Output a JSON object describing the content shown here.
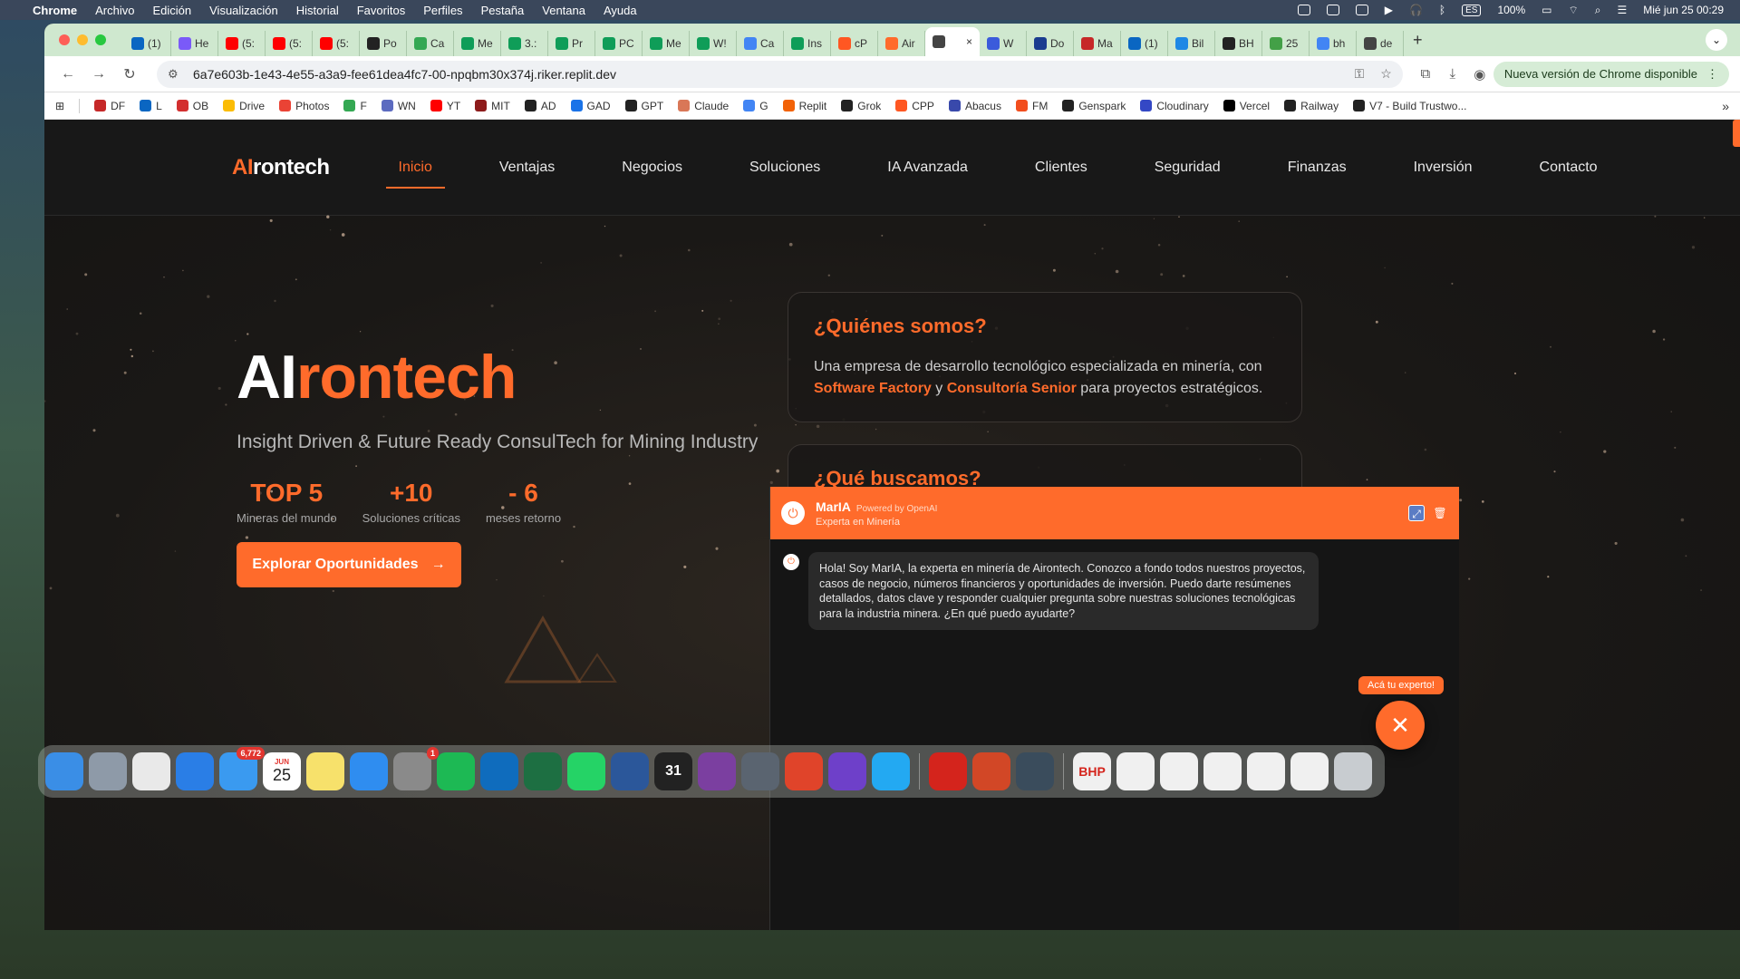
{
  "menubar": {
    "app": "Chrome",
    "items": [
      "Archivo",
      "Edición",
      "Visualización",
      "Historial",
      "Favoritos",
      "Perfiles",
      "Pestaña",
      "Ventana",
      "Ayuda"
    ],
    "battery": "100%",
    "input_lang": "ES",
    "clock": "Mié jun 25  00:29"
  },
  "tabs": [
    {
      "label": "(1)",
      "color": "#0a66c2"
    },
    {
      "label": "He",
      "color": "#7a5af8"
    },
    {
      "label": "(5:",
      "color": "#ff0000"
    },
    {
      "label": "(5:",
      "color": "#ff0000"
    },
    {
      "label": "(5:",
      "color": "#ff0000"
    },
    {
      "label": "Po",
      "color": "#222222"
    },
    {
      "label": "Ca",
      "color": "#34a853"
    },
    {
      "label": "Me",
      "color": "#0f9d58"
    },
    {
      "label": "3.:",
      "color": "#0f9d58"
    },
    {
      "label": "Pr",
      "color": "#0f9d58"
    },
    {
      "label": "PC",
      "color": "#0f9d58"
    },
    {
      "label": "Me",
      "color": "#0f9d58"
    },
    {
      "label": "W!",
      "color": "#0f9d58"
    },
    {
      "label": "Ca",
      "color": "#4285f4"
    },
    {
      "label": "Ins",
      "color": "#0f9d58"
    },
    {
      "label": "cP",
      "color": "#ff5722"
    },
    {
      "label": "Air",
      "color": "#ff6b2b"
    },
    {
      "label": "",
      "color": "#444444",
      "active": true
    },
    {
      "label": "W",
      "color": "#3b5bdb"
    },
    {
      "label": "Do",
      "color": "#1a3c8f"
    },
    {
      "label": "Ma",
      "color": "#c62828"
    },
    {
      "label": "(1)",
      "color": "#0a66c2"
    },
    {
      "label": "Bil",
      "color": "#1e88e5"
    },
    {
      "label": "BH",
      "color": "#222222"
    },
    {
      "label": "25",
      "color": "#43a047"
    },
    {
      "label": "bh",
      "color": "#4285f4"
    },
    {
      "label": "de",
      "color": "#444444"
    }
  ],
  "toolbar": {
    "url": "6a7e603b-1e43-4e55-a3a9-fee61dea4fc7-00-npqbm30x374j.riker.replit.dev",
    "update_label": "Nueva versión de Chrome disponible"
  },
  "bookmarks": [
    {
      "label": "DF",
      "color": "#c62828"
    },
    {
      "label": "L",
      "color": "#0a66c2"
    },
    {
      "label": "OB",
      "color": "#d32f2f"
    },
    {
      "label": "Drive",
      "color": "#fbbc04"
    },
    {
      "label": "Photos",
      "color": "#ea4335"
    },
    {
      "label": "F",
      "color": "#34a853"
    },
    {
      "label": "WN",
      "color": "#5c6bc0"
    },
    {
      "label": "YT",
      "color": "#ff0000"
    },
    {
      "label": "MIT",
      "color": "#8d1b1b"
    },
    {
      "label": "AD",
      "color": "#222222"
    },
    {
      "label": "GAD",
      "color": "#1a73e8"
    },
    {
      "label": "GPT",
      "color": "#222222"
    },
    {
      "label": "Claude",
      "color": "#d97757"
    },
    {
      "label": "G",
      "color": "#4285f4"
    },
    {
      "label": "Replit",
      "color": "#f26207"
    },
    {
      "label": "Grok",
      "color": "#222222"
    },
    {
      "label": "CPP",
      "color": "#ff5722"
    },
    {
      "label": "Abacus",
      "color": "#3949ab"
    },
    {
      "label": "FM",
      "color": "#f24e1e"
    },
    {
      "label": "Genspark",
      "color": "#222222"
    },
    {
      "label": "Cloudinary",
      "color": "#3448c5"
    },
    {
      "label": "Vercel",
      "color": "#000000"
    },
    {
      "label": "Railway",
      "color": "#222222"
    },
    {
      "label": "V7 - Build Trustwo...",
      "color": "#222222"
    }
  ],
  "site": {
    "logo_ai": "AI",
    "logo_rest": "rontech",
    "nav": [
      "Inicio",
      "Ventajas",
      "Negocios",
      "Soluciones",
      "IA Avanzada",
      "Clientes",
      "Seguridad",
      "Finanzas",
      "Inversión",
      "Contacto"
    ],
    "hero": {
      "title_a": "AI",
      "title_b": "rontech",
      "subtitle": "Insight Driven & Future Ready ConsulTech for Mining Industry",
      "stats": [
        {
          "num": "TOP 5",
          "label": "Mineras del mundo"
        },
        {
          "num": "+10",
          "label": "Soluciones críticas"
        },
        {
          "num": "- 6",
          "label": "meses retorno"
        }
      ],
      "cta": "Explorar Oportunidades"
    },
    "card1": {
      "title": "¿Quiénes somos?",
      "text_a": "Una empresa de desarrollo tecnológico especializada en minería, con",
      "hl1": "Software Factory",
      "text_b": "y",
      "hl2": "Consultoría Senior",
      "text_c": "para proyectos estratégicos."
    },
    "card2": {
      "title": "¿Qué buscamos?"
    }
  },
  "chat": {
    "name": "MarIA",
    "powered": "Powered by OpenAI",
    "role": "Experta en Minería",
    "message": "Hola! Soy MarIA, la experta en minería de Airontech. Conozco a fondo todos nuestros proyectos, casos de negocio, números financieros y oportunidades de inversión. Puedo darte resúmenes detallados, datos clave y responder cualquier pregunta sobre nuestras soluciones tecnológicas para la industria minera. ¿En qué puedo ayudarte?",
    "tooltip": "Acá tu experto!"
  },
  "dock": {
    "apps": [
      {
        "name": "finder",
        "color": "#3a8ee6"
      },
      {
        "name": "launchpad",
        "color": "#8e9aa8"
      },
      {
        "name": "chrome",
        "color": "#e9e9e9"
      },
      {
        "name": "safari",
        "color": "#2a7ee6"
      },
      {
        "name": "mail",
        "color": "#3a9af0",
        "badge": "6,772"
      },
      {
        "name": "calendar",
        "color": "#ffffff",
        "month": "JUN",
        "day": "25"
      },
      {
        "name": "notes",
        "color": "#f7e16b"
      },
      {
        "name": "keynote",
        "color": "#2f8df0"
      },
      {
        "name": "system-settings",
        "color": "#8a8a8a",
        "badge": "1"
      },
      {
        "name": "spotify",
        "color": "#1db954"
      },
      {
        "name": "outlook",
        "color": "#0f6cbd"
      },
      {
        "name": "excel",
        "color": "#1d6f42"
      },
      {
        "name": "whatsapp",
        "color": "#25d366"
      },
      {
        "name": "word",
        "color": "#2b579a"
      },
      {
        "name": "fantastical",
        "color": "#222222",
        "day": "31"
      },
      {
        "name": "screen-recorder",
        "color": "#7b3fa0"
      },
      {
        "name": "iphone-mirroring",
        "color": "#5a6470"
      },
      {
        "name": "app-x",
        "color": "#e0442a"
      },
      {
        "name": "github-desktop",
        "color": "#6e40c9"
      },
      {
        "name": "vscode",
        "color": "#23a9f2"
      },
      {
        "name": "acrobat",
        "color": "#d4241c"
      },
      {
        "name": "powerpoint",
        "color": "#d24726"
      },
      {
        "name": "quicktime",
        "color": "#3a4c5c"
      },
      {
        "name": "bhp-doc",
        "color": "#f0f0f0",
        "label": "BHP"
      },
      {
        "name": "doc-1",
        "color": "#f0f0f0"
      },
      {
        "name": "doc-2",
        "color": "#f0f0f0"
      },
      {
        "name": "doc-3",
        "color": "#f0f0f0"
      },
      {
        "name": "doc-4",
        "color": "#f0f0f0"
      },
      {
        "name": "doc-5",
        "color": "#f0f0f0"
      },
      {
        "name": "trash",
        "color": "#c8ccd0"
      }
    ]
  },
  "colors": {
    "accent": "#ff6b2b",
    "page_bg": "#1a1816"
  }
}
